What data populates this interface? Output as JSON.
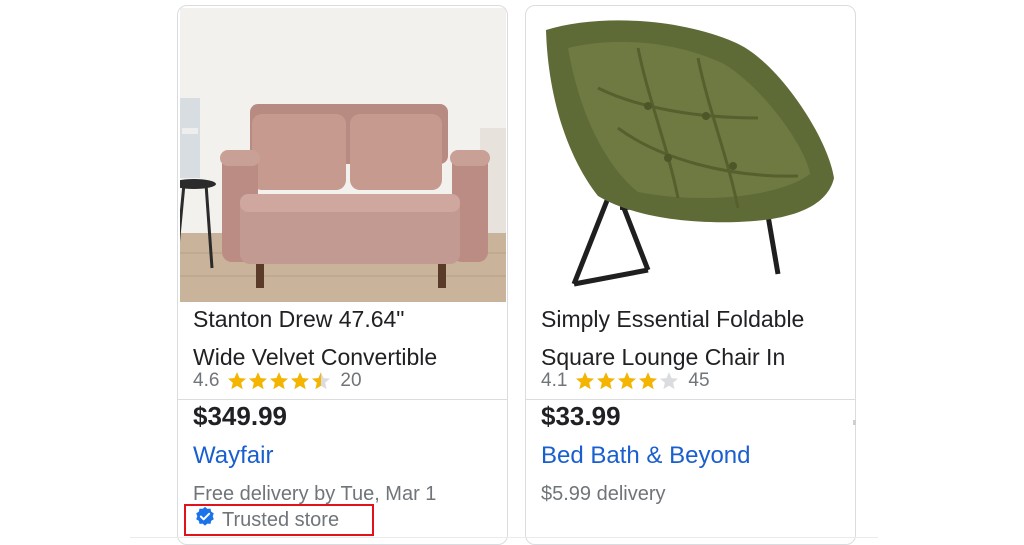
{
  "products": [
    {
      "image_alt": "Pink velvet convertible sofa",
      "title_line1": "Stanton Drew 47.64\"",
      "title_line2": "Wide Velvet Convertible",
      "rating": "4.6",
      "stars": 4.5,
      "review_count": "20",
      "price": "$349.99",
      "store": "Wayfair",
      "delivery": "Free delivery by Tue, Mar 1",
      "badge": "Trusted store",
      "badge_icon": "verified-check-icon"
    },
    {
      "image_alt": "Green padded folding lounge chair",
      "title_line1": "Simply Essential Foldable",
      "title_line2": "Square Lounge Chair In",
      "rating": "4.1",
      "stars": 4,
      "review_count": "45",
      "price": "$33.99",
      "store": "Bed Bath & Beyond",
      "delivery": "$5.99 delivery"
    }
  ],
  "colors": {
    "link_blue": "#1a5fcf",
    "star_gold": "#f4b400",
    "highlight_red": "#e0121b",
    "badge_blue": "#1a73e8"
  }
}
